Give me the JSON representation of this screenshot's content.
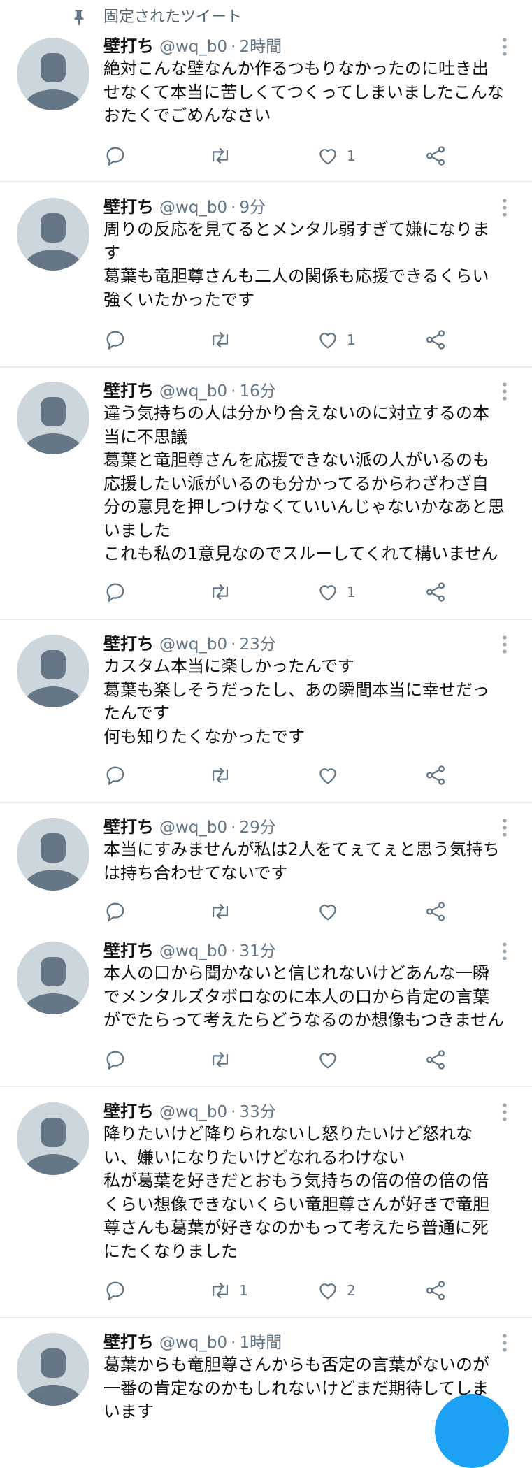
{
  "pinned_label": "固定されたツイート",
  "accent_color": "#1da1f2",
  "tweets": [
    {
      "author": "壁打ち",
      "handle": "@wq_b0",
      "time": "2時間",
      "text": "絶対こんな壁なんか作るつもりなかったのに吐き出\nせなくて本当に苦しくてつくってしまいましたこんな\nおたくでごめんなさい",
      "retweets": "",
      "likes": "1"
    },
    {
      "author": "壁打ち",
      "handle": "@wq_b0",
      "time": "9分",
      "text": "周りの反応を見てるとメンタル弱すぎて嫌になりま\nす\n葛葉も竜胆尊さんも二人の関係も応援できるくらい\n強くいたかったです",
      "retweets": "",
      "likes": "1"
    },
    {
      "author": "壁打ち",
      "handle": "@wq_b0",
      "time": "16分",
      "text": "違う気持ちの人は分かり合えないのに対立するの本\n当に不思議\n葛葉と竜胆尊さんを応援できない派の人がいるのも\n応援したい派がいるのも分かってるからわざわざ自\n分の意見を押しつけなくていいんじゃないかなあと思\nいました\nこれも私の1意見なのでスルーしてくれて構いません",
      "retweets": "",
      "likes": "1"
    },
    {
      "author": "壁打ち",
      "handle": "@wq_b0",
      "time": "23分",
      "text": "カスタム本当に楽しかったんです\n葛葉も楽しそうだったし、あの瞬間本当に幸せだっ\nたんです\n何も知りたくなかったです",
      "retweets": "",
      "likes": ""
    },
    {
      "author": "壁打ち",
      "handle": "@wq_b0",
      "time": "29分",
      "text": "本当にすみませんが私は2人をてぇてぇと思う気持ち\nは持ち合わせてないです",
      "retweets": "",
      "likes": ""
    },
    {
      "author": "壁打ち",
      "handle": "@wq_b0",
      "time": "31分",
      "text": "本人の口から聞かないと信じれないけどあんな一瞬\nでメンタルズタボロなのに本人の口から肯定の言葉\nがでたらって考えたらどうなるのか想像もつきません",
      "retweets": "",
      "likes": ""
    },
    {
      "author": "壁打ち",
      "handle": "@wq_b0",
      "time": "33分",
      "text": "降りたいけど降りられないし怒りたいけど怒れな\nい、嫌いになりたいけどなれるわけない\n私が葛葉を好きだとおもう気持ちの倍の倍の倍の倍\nくらい想像できないくらい竜胆尊さんが好きで竜胆\n尊さんも葛葉が好きなのかもって考えたら普通に死\nにたくなりました",
      "retweets": "1",
      "likes": "2"
    },
    {
      "author": "壁打ち",
      "handle": "@wq_b0",
      "time": "1時間",
      "text": "葛葉からも竜胆尊さんからも否定の言葉がないのが\n一番の肯定なのかもしれないけどまだ期待してしま\nいます",
      "retweets": "",
      "likes": ""
    }
  ]
}
